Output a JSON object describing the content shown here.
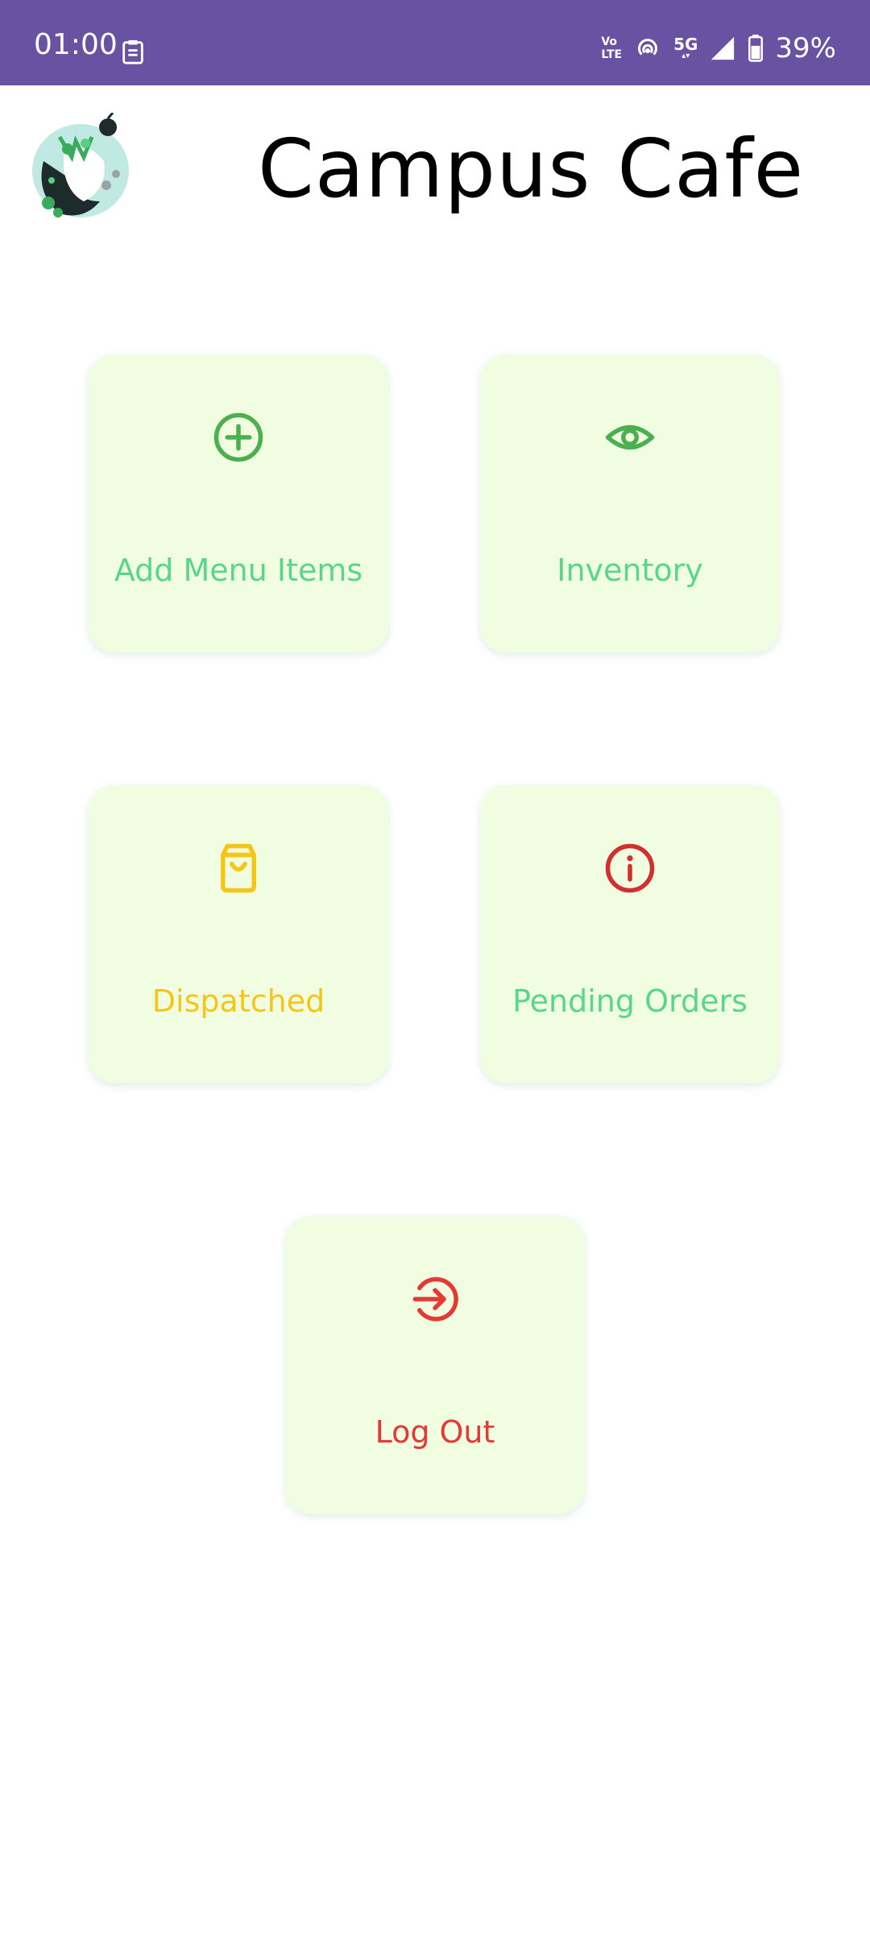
{
  "status_bar": {
    "time": "01:00",
    "network_top": "Vo",
    "network_bottom": "LTE",
    "signal_label": "5G",
    "battery": "39%",
    "background_color": "#6a52a3"
  },
  "header": {
    "title": "Campus Cafe",
    "logo_icon": "cafe-logo-icon"
  },
  "menu": {
    "add_menu_items": {
      "label": "Add Menu Items",
      "icon": "plus-circle-icon",
      "color": "#5ad68a",
      "icon_color": "#4caf50"
    },
    "inventory": {
      "label": "Inventory",
      "icon": "eye-icon",
      "color": "#5ad68a",
      "icon_color": "#4caf50"
    },
    "dispatched": {
      "label": "Dispatched",
      "icon": "shopping-bag-icon",
      "color": "#f5c518",
      "icon_color": "#f5c518"
    },
    "pending_orders": {
      "label": "Pending Orders",
      "icon": "info-icon",
      "color": "#5ad68a",
      "icon_color": "#d32f2f"
    },
    "log_out": {
      "label": "Log Out",
      "icon": "log-out-icon",
      "color": "#e53935",
      "icon_color": "#e53935"
    }
  },
  "card_background": "#f0fde0"
}
